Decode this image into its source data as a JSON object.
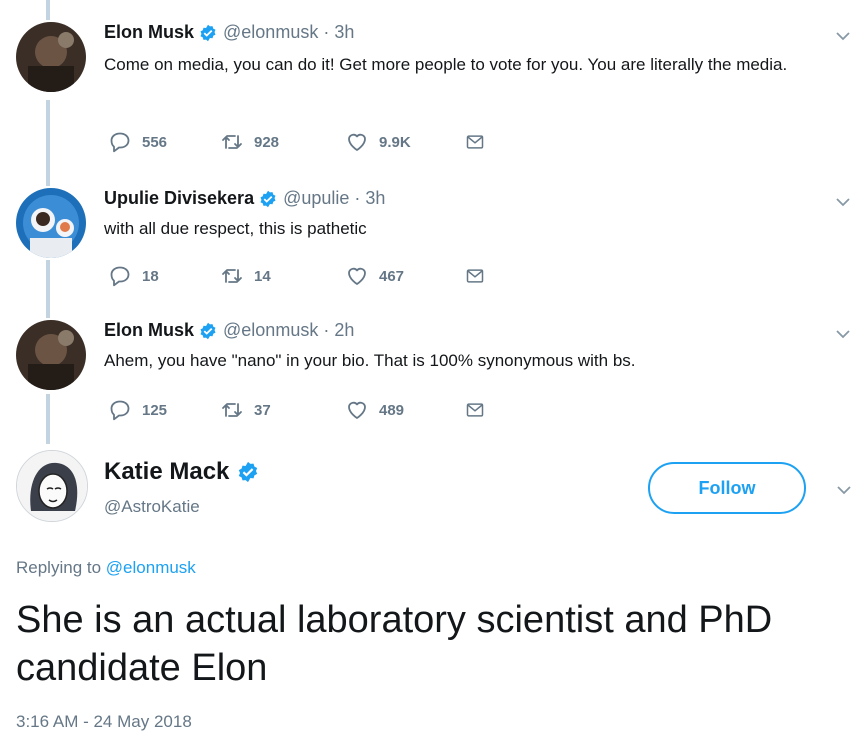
{
  "thread": [
    {
      "name": "Elon Musk",
      "handle": "@elonmusk",
      "time": "3h",
      "text": "Come on media, you can do it! Get more people to vote for you. You are literally the media.",
      "replies": "556",
      "retweets": "928",
      "likes": "9.9K"
    },
    {
      "name": "Upulie Divisekera",
      "handle": "@upulie",
      "time": "3h",
      "text": "with all due respect, this is pathetic",
      "replies": "18",
      "retweets": "14",
      "likes": "467"
    },
    {
      "name": "Elon Musk",
      "handle": "@elonmusk",
      "time": "2h",
      "text": "Ahem, you have \"nano\" in your bio. That is 100% synonymous with bs.",
      "replies": "125",
      "retweets": "37",
      "likes": "489"
    }
  ],
  "main": {
    "name": "Katie Mack",
    "handle": "@AstroKatie",
    "follow_label": "Follow",
    "replying_prefix": "Replying to",
    "replying_to": "@elonmusk",
    "text": "She is an actual laboratory scientist and PhD candidate Elon",
    "timestamp": "3:16 AM - 24 May 2018"
  },
  "separator": "·",
  "colors": {
    "accent": "#1da1f2",
    "muted": "#657786",
    "thread_line": "#c4d3e0"
  },
  "icons": [
    "verified-icon",
    "reply-icon",
    "retweet-icon",
    "like-icon",
    "dm-icon",
    "chevron-down-icon"
  ]
}
